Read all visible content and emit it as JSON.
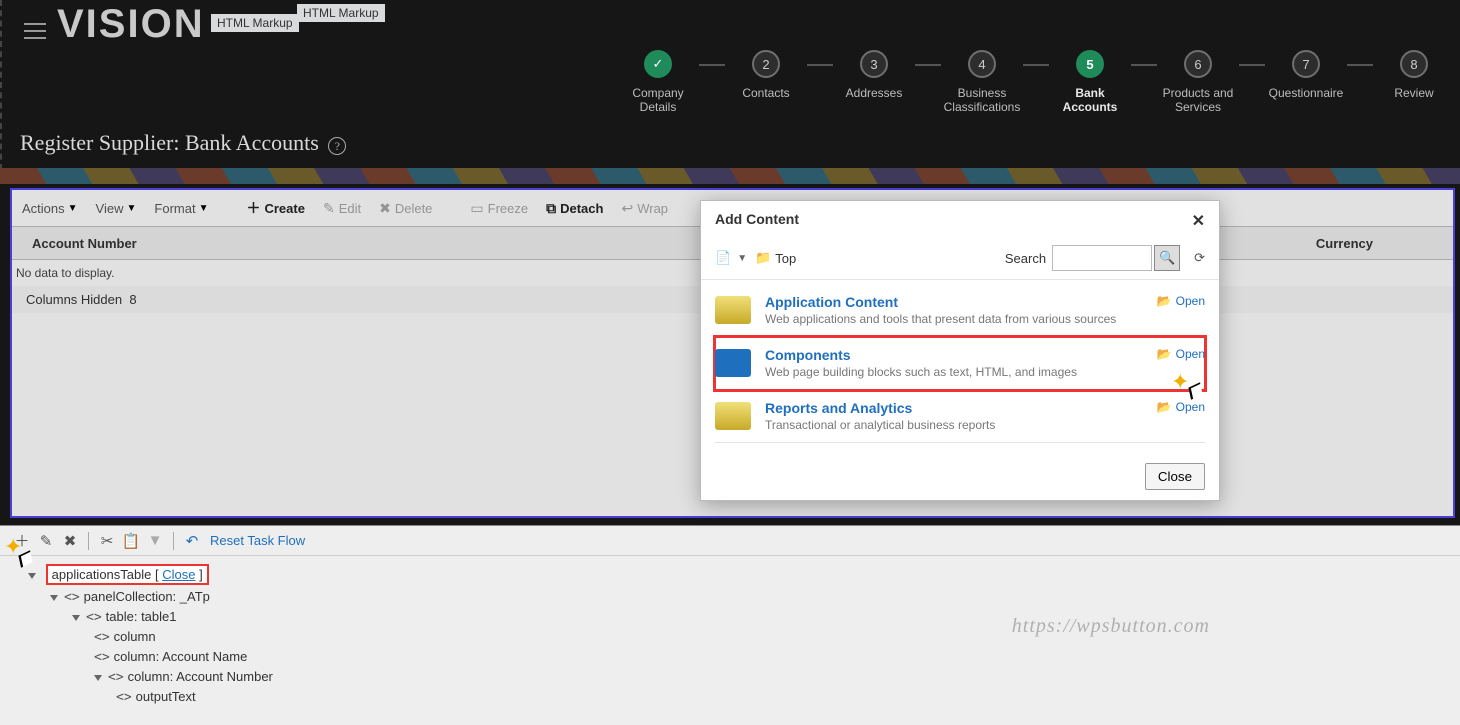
{
  "brand": "VISION",
  "tags": [
    "HTML Markup",
    "HTML Markup"
  ],
  "wizard": [
    {
      "num": "✓",
      "label": "Company Details",
      "state": "done"
    },
    {
      "num": "2",
      "label": "Contacts",
      "state": ""
    },
    {
      "num": "3",
      "label": "Addresses",
      "state": ""
    },
    {
      "num": "4",
      "label": "Business Classifications",
      "state": ""
    },
    {
      "num": "5",
      "label": "Bank Accounts",
      "state": "active"
    },
    {
      "num": "6",
      "label": "Products and Services",
      "state": ""
    },
    {
      "num": "7",
      "label": "Questionnaire",
      "state": ""
    },
    {
      "num": "8",
      "label": "Review",
      "state": ""
    }
  ],
  "page_title": "Register Supplier: Bank Accounts",
  "toolbar": {
    "actions": "Actions",
    "view": "View",
    "format": "Format",
    "create": "Create",
    "edit": "Edit",
    "delete": "Delete",
    "freeze": "Freeze",
    "detach": "Detach",
    "wrap": "Wrap"
  },
  "table": {
    "col1": "Account Number",
    "col2": "Currency",
    "nodata": "No data to display.",
    "hidden_label": "Columns Hidden",
    "hidden_count": "8"
  },
  "modal": {
    "title": "Add Content",
    "crumb": "Top",
    "search_label": "Search",
    "items": [
      {
        "title": "Application Content",
        "desc": "Web applications and tools that present data from various sources",
        "open": "Open"
      },
      {
        "title": "Components",
        "desc": "Web page building blocks such as text, HTML, and images",
        "open": "Open",
        "hl": true,
        "blue": true
      },
      {
        "title": "Reports and Analytics",
        "desc": "Transactional or analytical business reports",
        "open": "Open"
      }
    ],
    "close": "Close"
  },
  "bottom": {
    "reset": "Reset Task Flow",
    "sel_node": "applicationsTable",
    "sel_close": "Close",
    "tree": [
      {
        "indent": 1,
        "txt": "panelCollection: _ATp",
        "tri": true
      },
      {
        "indent": 2,
        "txt": "table: table1",
        "tri": true
      },
      {
        "indent": 3,
        "txt": "column"
      },
      {
        "indent": 3,
        "txt": "column: Account Name"
      },
      {
        "indent": 3,
        "txt": "column: Account Number",
        "tri": true
      },
      {
        "indent": 4,
        "txt": "outputText"
      }
    ]
  },
  "watermark": "https://wpsbutton.com"
}
